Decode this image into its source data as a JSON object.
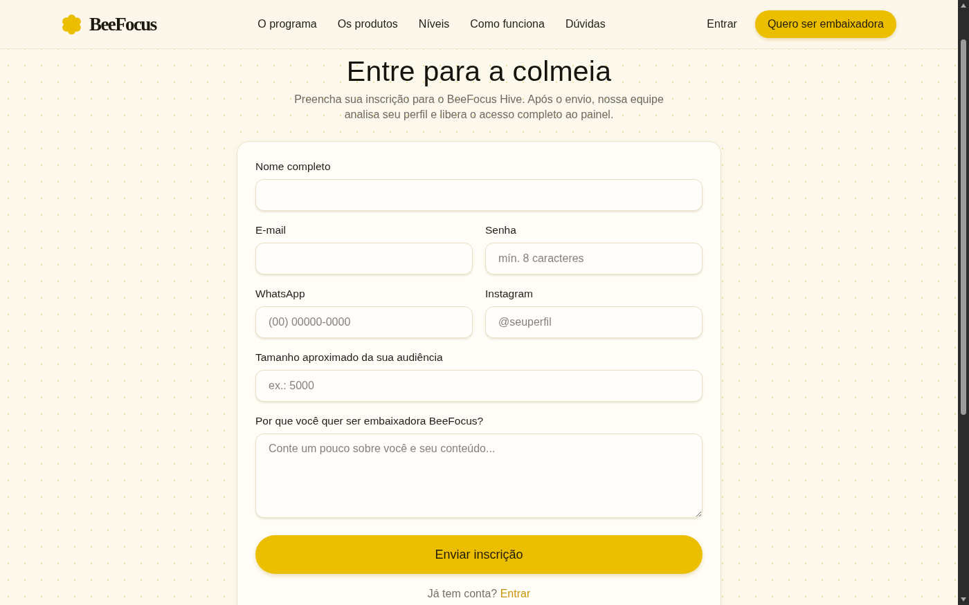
{
  "header": {
    "logo": "BeeFocus",
    "nav": [
      "O programa",
      "Os produtos",
      "Níveis",
      "Como funciona",
      "Dúvidas"
    ],
    "login_link": "Entrar",
    "cta_button": "Quero ser embaixadora"
  },
  "hero": {
    "title": "Entre para a colmeia",
    "subtitle": "Preencha sua inscrição para o BeeFocus Hive. Após o envio, nossa equipe analisa seu perfil e libera o acesso completo ao painel."
  },
  "form": {
    "rows": [
      [
        {
          "label": "Nome completo",
          "kind": "input"
        }
      ],
      [
        {
          "label": "E-mail",
          "kind": "input"
        },
        {
          "label": "Senha",
          "kind": "input",
          "placeholder": "mín. 8 caracteres"
        }
      ],
      [
        {
          "label": "WhatsApp",
          "kind": "input",
          "placeholder": "(00) 00000-0000"
        },
        {
          "label": "Instagram",
          "kind": "input",
          "placeholder": "@seuperfil"
        }
      ],
      [
        {
          "label": "Tamanho aproximado da sua audiência",
          "kind": "input",
          "placeholder": "ex.: 5000"
        }
      ],
      [
        {
          "label": "Por que você quer ser embaixadora BeeFocus?",
          "kind": "textarea",
          "placeholder": "Conte um pouco sobre você e seu conteúdo..."
        }
      ]
    ],
    "submit_button": "Enviar inscrição",
    "footer_text": "Já tem conta?",
    "footer_link": "Entrar"
  }
}
